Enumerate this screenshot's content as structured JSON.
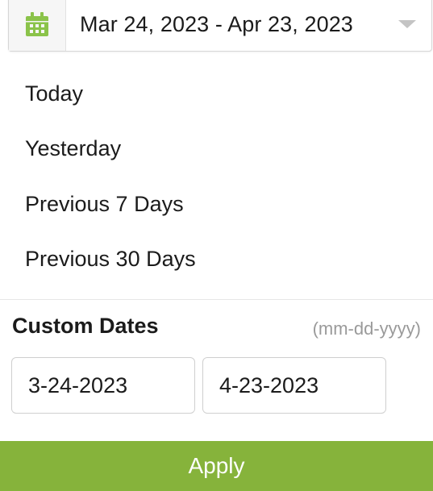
{
  "range_selector": {
    "icon": "calendar-icon",
    "label": "Mar 24, 2023 - Apr 23, 2023",
    "caret_icon": "chevron-down-icon"
  },
  "presets": [
    {
      "label": "Today"
    },
    {
      "label": "Yesterday"
    },
    {
      "label": "Previous 7 Days"
    },
    {
      "label": "Previous 30 Days"
    }
  ],
  "custom": {
    "title": "Custom Dates",
    "format_hint": "(mm-dd-yyyy)",
    "start_value": "3-24-2023",
    "end_value": "4-23-2023"
  },
  "apply_label": "Apply",
  "colors": {
    "accent": "#86b33b",
    "icon_green": "#8bc34a",
    "hint_gray": "#9a9a9a",
    "border": "#cfcfcf"
  }
}
